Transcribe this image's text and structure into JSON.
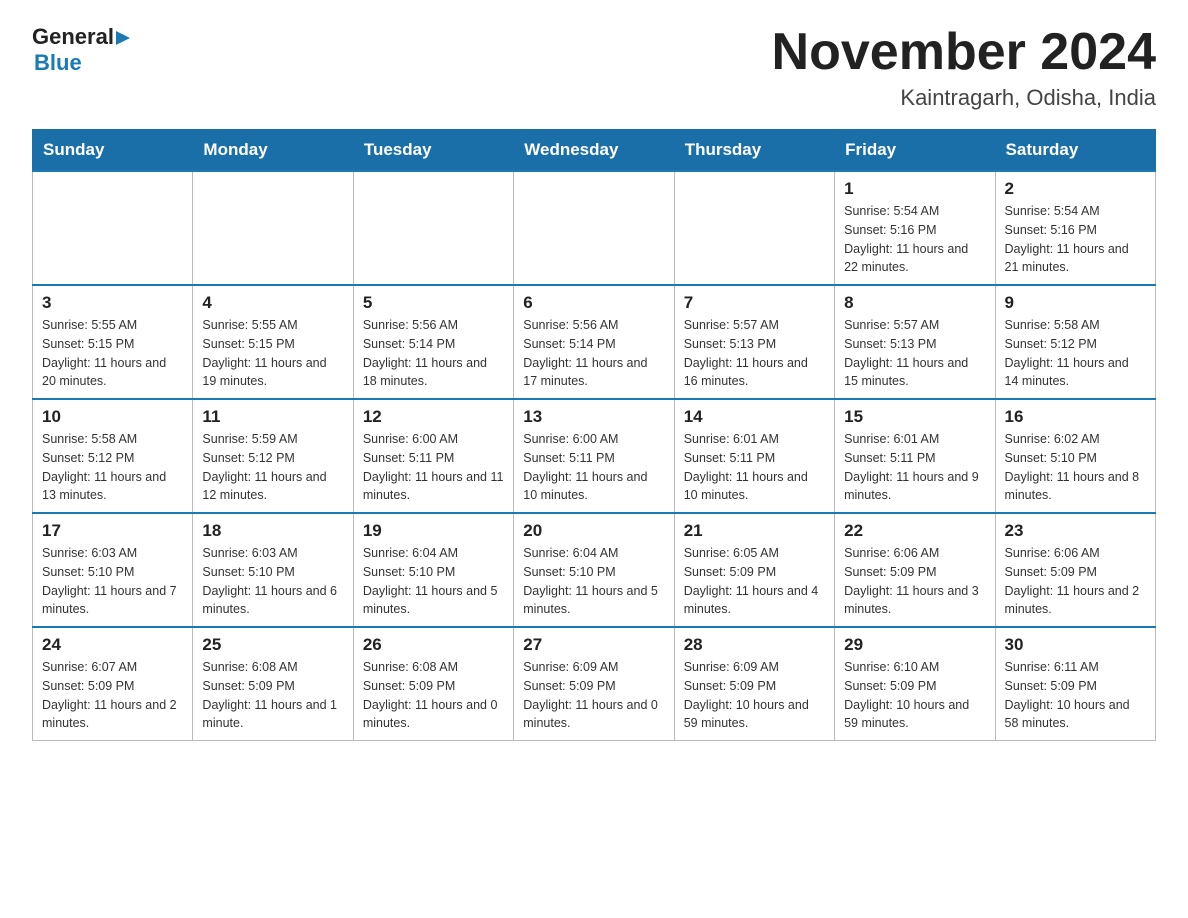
{
  "header": {
    "logo": {
      "general": "General",
      "blue": "Blue",
      "arrow": "▶"
    },
    "title": "November 2024",
    "subtitle": "Kaintragarh, Odisha, India"
  },
  "days_of_week": [
    "Sunday",
    "Monday",
    "Tuesday",
    "Wednesday",
    "Thursday",
    "Friday",
    "Saturday"
  ],
  "weeks": [
    [
      {
        "day": "",
        "info": ""
      },
      {
        "day": "",
        "info": ""
      },
      {
        "day": "",
        "info": ""
      },
      {
        "day": "",
        "info": ""
      },
      {
        "day": "",
        "info": ""
      },
      {
        "day": "1",
        "info": "Sunrise: 5:54 AM\nSunset: 5:16 PM\nDaylight: 11 hours and 22 minutes."
      },
      {
        "day": "2",
        "info": "Sunrise: 5:54 AM\nSunset: 5:16 PM\nDaylight: 11 hours and 21 minutes."
      }
    ],
    [
      {
        "day": "3",
        "info": "Sunrise: 5:55 AM\nSunset: 5:15 PM\nDaylight: 11 hours and 20 minutes."
      },
      {
        "day": "4",
        "info": "Sunrise: 5:55 AM\nSunset: 5:15 PM\nDaylight: 11 hours and 19 minutes."
      },
      {
        "day": "5",
        "info": "Sunrise: 5:56 AM\nSunset: 5:14 PM\nDaylight: 11 hours and 18 minutes."
      },
      {
        "day": "6",
        "info": "Sunrise: 5:56 AM\nSunset: 5:14 PM\nDaylight: 11 hours and 17 minutes."
      },
      {
        "day": "7",
        "info": "Sunrise: 5:57 AM\nSunset: 5:13 PM\nDaylight: 11 hours and 16 minutes."
      },
      {
        "day": "8",
        "info": "Sunrise: 5:57 AM\nSunset: 5:13 PM\nDaylight: 11 hours and 15 minutes."
      },
      {
        "day": "9",
        "info": "Sunrise: 5:58 AM\nSunset: 5:12 PM\nDaylight: 11 hours and 14 minutes."
      }
    ],
    [
      {
        "day": "10",
        "info": "Sunrise: 5:58 AM\nSunset: 5:12 PM\nDaylight: 11 hours and 13 minutes."
      },
      {
        "day": "11",
        "info": "Sunrise: 5:59 AM\nSunset: 5:12 PM\nDaylight: 11 hours and 12 minutes."
      },
      {
        "day": "12",
        "info": "Sunrise: 6:00 AM\nSunset: 5:11 PM\nDaylight: 11 hours and 11 minutes."
      },
      {
        "day": "13",
        "info": "Sunrise: 6:00 AM\nSunset: 5:11 PM\nDaylight: 11 hours and 10 minutes."
      },
      {
        "day": "14",
        "info": "Sunrise: 6:01 AM\nSunset: 5:11 PM\nDaylight: 11 hours and 10 minutes."
      },
      {
        "day": "15",
        "info": "Sunrise: 6:01 AM\nSunset: 5:11 PM\nDaylight: 11 hours and 9 minutes."
      },
      {
        "day": "16",
        "info": "Sunrise: 6:02 AM\nSunset: 5:10 PM\nDaylight: 11 hours and 8 minutes."
      }
    ],
    [
      {
        "day": "17",
        "info": "Sunrise: 6:03 AM\nSunset: 5:10 PM\nDaylight: 11 hours and 7 minutes."
      },
      {
        "day": "18",
        "info": "Sunrise: 6:03 AM\nSunset: 5:10 PM\nDaylight: 11 hours and 6 minutes."
      },
      {
        "day": "19",
        "info": "Sunrise: 6:04 AM\nSunset: 5:10 PM\nDaylight: 11 hours and 5 minutes."
      },
      {
        "day": "20",
        "info": "Sunrise: 6:04 AM\nSunset: 5:10 PM\nDaylight: 11 hours and 5 minutes."
      },
      {
        "day": "21",
        "info": "Sunrise: 6:05 AM\nSunset: 5:09 PM\nDaylight: 11 hours and 4 minutes."
      },
      {
        "day": "22",
        "info": "Sunrise: 6:06 AM\nSunset: 5:09 PM\nDaylight: 11 hours and 3 minutes."
      },
      {
        "day": "23",
        "info": "Sunrise: 6:06 AM\nSunset: 5:09 PM\nDaylight: 11 hours and 2 minutes."
      }
    ],
    [
      {
        "day": "24",
        "info": "Sunrise: 6:07 AM\nSunset: 5:09 PM\nDaylight: 11 hours and 2 minutes."
      },
      {
        "day": "25",
        "info": "Sunrise: 6:08 AM\nSunset: 5:09 PM\nDaylight: 11 hours and 1 minute."
      },
      {
        "day": "26",
        "info": "Sunrise: 6:08 AM\nSunset: 5:09 PM\nDaylight: 11 hours and 0 minutes."
      },
      {
        "day": "27",
        "info": "Sunrise: 6:09 AM\nSunset: 5:09 PM\nDaylight: 11 hours and 0 minutes."
      },
      {
        "day": "28",
        "info": "Sunrise: 6:09 AM\nSunset: 5:09 PM\nDaylight: 10 hours and 59 minutes."
      },
      {
        "day": "29",
        "info": "Sunrise: 6:10 AM\nSunset: 5:09 PM\nDaylight: 10 hours and 59 minutes."
      },
      {
        "day": "30",
        "info": "Sunrise: 6:11 AM\nSunset: 5:09 PM\nDaylight: 10 hours and 58 minutes."
      }
    ]
  ]
}
